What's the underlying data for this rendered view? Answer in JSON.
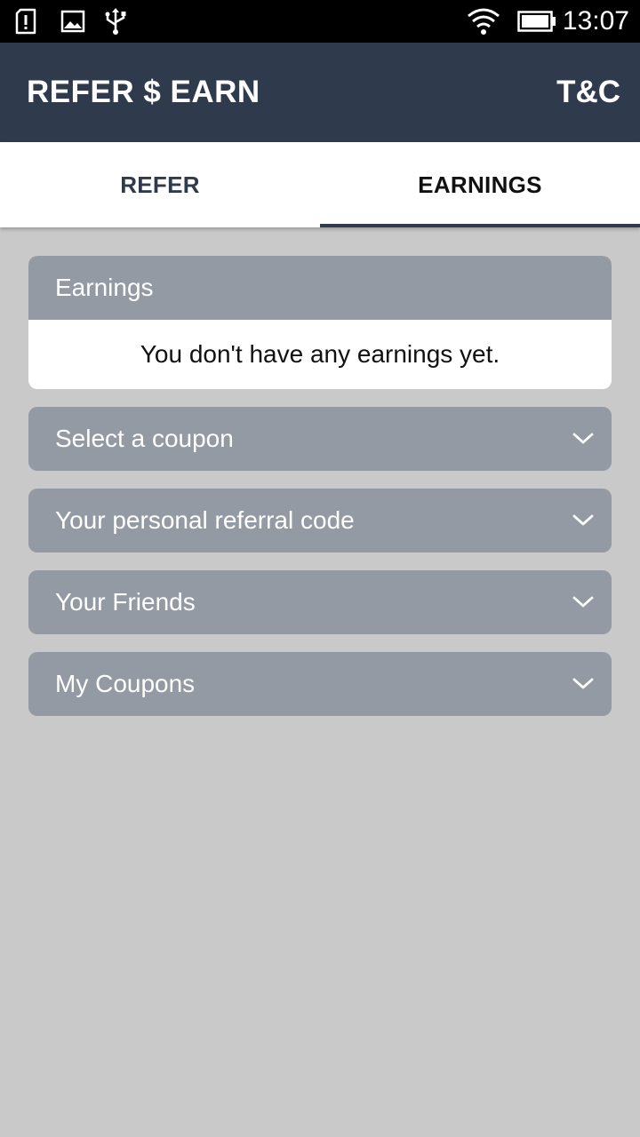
{
  "status_bar": {
    "time": "13:07",
    "icons": [
      "sim-alert-icon",
      "image-icon",
      "usb-icon",
      "wifi-icon",
      "battery-icon"
    ]
  },
  "app_bar": {
    "title": "REFER $ EARN",
    "action": "T&C"
  },
  "tabs": [
    {
      "label": "REFER",
      "selected": false
    },
    {
      "label": "EARNINGS",
      "selected": true
    }
  ],
  "earnings_card": {
    "header": "Earnings",
    "message": "You don't have any earnings yet."
  },
  "sections": [
    {
      "label": "Select a coupon",
      "icon": "chevron-down-icon"
    },
    {
      "label": "Your personal referral code",
      "icon": "chevron-down-icon"
    },
    {
      "label": "Your Friends",
      "icon": "chevron-down-icon"
    },
    {
      "label": "My Coupons",
      "icon": "chevron-down-icon"
    }
  ],
  "colors": {
    "app_bar": "#2f3b4d",
    "section_header": "#939aa4",
    "background": "#c9c9c9"
  }
}
